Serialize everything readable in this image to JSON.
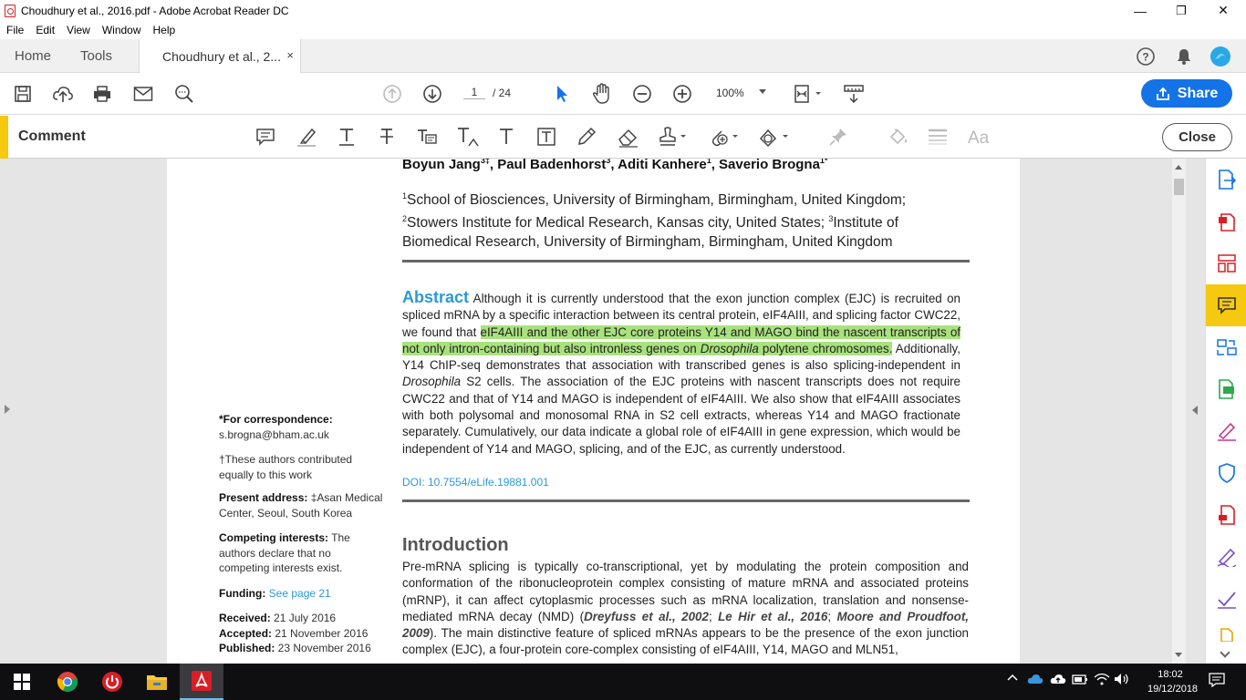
{
  "window": {
    "title": "Choudhury et al., 2016.pdf - Adobe Acrobat Reader DC",
    "minimize": "—",
    "restore": "❐",
    "close": "✕"
  },
  "menu": [
    "File",
    "Edit",
    "View",
    "Window",
    "Help"
  ],
  "tabs": {
    "home": "Home",
    "tools": "Tools",
    "document": "Choudhury et al., 2...",
    "close_glyph": "×"
  },
  "toolbar": {
    "page_current": "1",
    "page_total": "/ 24",
    "zoom": "100%",
    "share_label": "Share"
  },
  "comment_bar": {
    "label": "Comment",
    "close_label": "Close"
  },
  "document": {
    "authors": {
      "prefix": "Boyun Jang",
      "s1": "3‡",
      "a2": ", Paul Badenhorst",
      "s2": "3",
      "a3": ", Aditi Kanhere",
      "s3": "1",
      "a4": ", Saverio Brogna",
      "s4": "1*"
    },
    "affiliations": {
      "s1": "1",
      "t1": "School of Biosciences, University of Birmingham, Birmingham, United Kingdom;",
      "s2": "2",
      "t2": "Stowers Institute for Medical Research, Kansas city, United States; ",
      "s3": "3",
      "t3": "Institute of Biomedical Research, University of Birmingham, Birmingham, United Kingdom"
    },
    "abstract": {
      "heading": "Abstract",
      "text_before": " Although it is currently understood that the exon junction complex (EJC) is recruited on spliced mRNA by a specific interaction between its central protein, eIF4AIII, and splicing factor CWC22, we found that ",
      "highlight_a": "eIF4AIII and the other EJC core proteins Y14 and MAGO bind the nascent transcripts of not only intron-containing but also intronless genes on ",
      "highlight_italic": "Drosophila",
      "highlight_b": " polytene chromosomes.",
      "text_mid": " Additionally, Y14 ChIP-seq demonstrates that association with transcribed genes is also splicing-independent in ",
      "italic_2": "Drosophila",
      "text_after": " S2 cells. The association of the EJC proteins with nascent transcripts does not require CWC22 and that of Y14 and MAGO is independent of eIF4AIII. We also show that eIF4AIII associates with both polysomal and monosomal RNA in S2 cell extracts, whereas Y14 and MAGO fractionate separately. Cumulatively, our data indicate a global role of eIF4AIII in gene expression, which would be independent of Y14 and MAGO, splicing, and of the EJC, as currently understood.",
      "doi": "DOI: 10.7554/eLife.19881.001"
    },
    "introduction": {
      "heading": "Introduction",
      "p1": "Pre-mRNA splicing is typically co-transcriptional, yet by modulating the protein composition and conformation of the ribonucleoprotein complex consisting of mature mRNA and associated proteins (mRNP), it can affect cytoplasmic processes such as mRNA localization, translation and nonsense-mediated mRNA decay (NMD) (",
      "c1": "Dreyfuss et al., 2002",
      "sep1": "; ",
      "c2": "Le Hir et al., 2016",
      "sep2": "; ",
      "c3": "Moore and Proudfoot, 2009",
      "p2": "). The main distinctive feature of spliced mRNAs appears to be the presence of the exon junction complex (EJC), a four-protein core-complex consisting of eIF4AIII, Y14, MAGO and MLN51,"
    },
    "sidebar": {
      "correspondence_label": "*For correspondence:",
      "correspondence_value": " s.brogna@bham.ac.uk",
      "equal": "†These authors contributed equally to this work",
      "present_label": "Present address:",
      "present_value": " ‡Asan Medical Center, Seoul, South Korea",
      "competing_label": "Competing interests:",
      "competing_value": " The authors declare that no competing interests exist.",
      "funding_label": "Funding:",
      "funding_value": "See page 21",
      "received_label": "Received:",
      "received_value": " 21 July 2016",
      "accepted_label": "Accepted:",
      "accepted_value": " 21 November 2016",
      "published_label": "Published:",
      "published_value": " 23 November 2016"
    }
  },
  "taskbar": {
    "time": "18:02",
    "date": "19/12/2018"
  },
  "colors": {
    "accent_blue": "#1473e6",
    "comment_yellow": "#f5c90f",
    "highlight_green": "#a9e27d",
    "link_blue": "#2a9ad6"
  }
}
